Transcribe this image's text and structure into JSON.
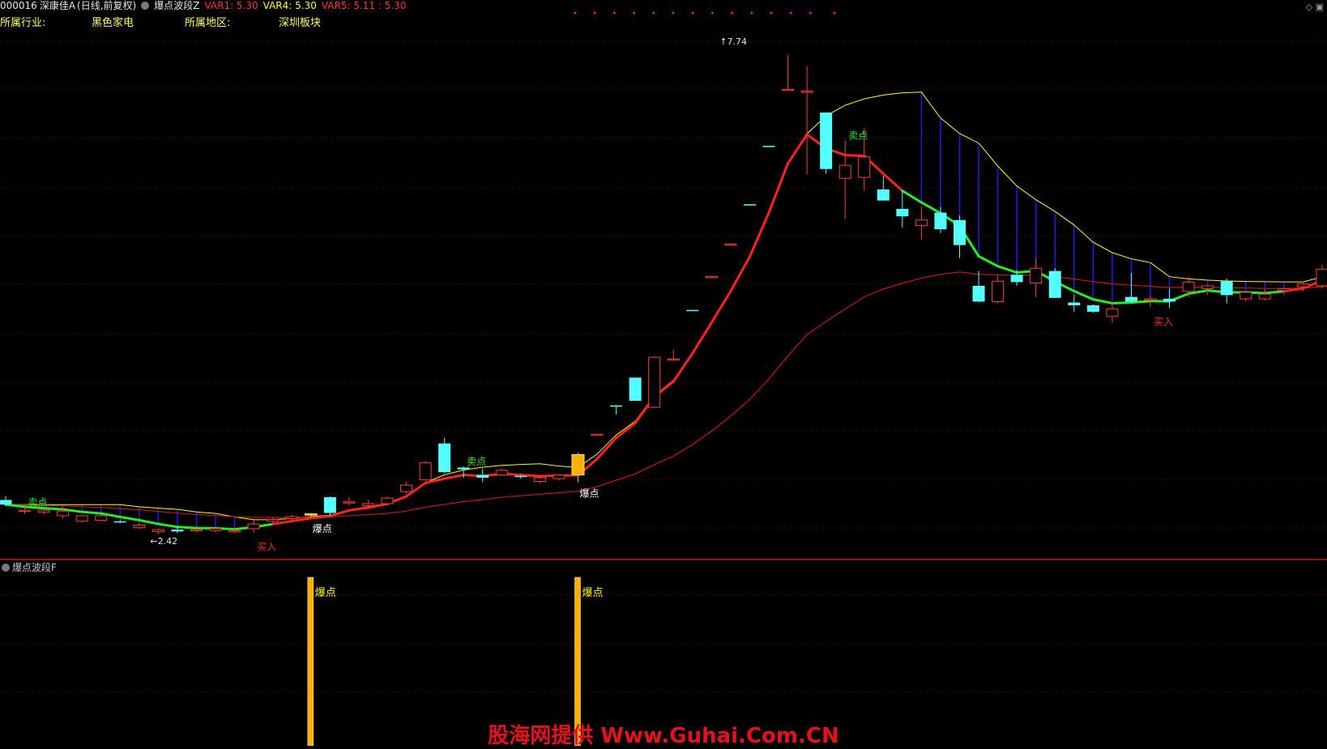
{
  "header": {
    "code": "000016",
    "name": "深康佳A",
    "mode": "(日线,前复权)",
    "indicator": "爆点波段Z",
    "var1": "VAR1: 5.30",
    "var4": "VAR4: 5.30",
    "var5": "VAR5: 5.11 : 5.30"
  },
  "info": {
    "industry_label": "所属行业:",
    "industry_value": "黑色家电",
    "region_label": "所属地区:",
    "region_value": "深圳板块"
  },
  "sub_panel": {
    "title": "爆点波段F"
  },
  "watermark": "股海网提供 Www.Guhai.Com.CN",
  "colors": {
    "up": "#ff3b3b",
    "down": "#54ffff",
    "yellow": "#ffff00",
    "green": "#22ee22",
    "red": "#ff2020",
    "darkred": "#c81414",
    "blue": "#1a1ae6",
    "orange": "#ffb000",
    "grid": "#7a0000",
    "magenta": "#ff00ff"
  },
  "chart_data": {
    "type": "candlestick",
    "ylim": [
      2.2,
      8.0
    ],
    "candles": [
      [
        2.79,
        2.83,
        2.73,
        2.74
      ],
      [
        2.67,
        2.71,
        2.64,
        2.68
      ],
      [
        2.66,
        2.7,
        2.63,
        2.68
      ],
      [
        2.62,
        2.71,
        2.59,
        2.67
      ],
      [
        2.56,
        2.63,
        2.55,
        2.62
      ],
      [
        2.57,
        2.63,
        2.56,
        2.62
      ],
      [
        2.56,
        2.58,
        2.54,
        2.55
      ],
      [
        2.49,
        2.55,
        2.48,
        2.52
      ],
      [
        2.45,
        2.48,
        2.42,
        2.47
      ],
      [
        2.47,
        2.5,
        2.43,
        2.45
      ],
      [
        2.46,
        2.49,
        2.44,
        2.47
      ],
      [
        2.46,
        2.49,
        2.44,
        2.48
      ],
      [
        2.45,
        2.49,
        2.43,
        2.46
      ],
      [
        2.48,
        2.56,
        2.44,
        2.53
      ],
      [
        2.56,
        2.6,
        2.53,
        2.58
      ],
      [
        2.59,
        2.63,
        2.57,
        2.61
      ],
      [
        2.63,
        2.65,
        2.6,
        2.64
      ],
      [
        2.82,
        2.83,
        2.62,
        2.65
      ],
      [
        2.76,
        2.82,
        2.73,
        2.77
      ],
      [
        2.73,
        2.79,
        2.7,
        2.75
      ],
      [
        2.75,
        2.83,
        2.73,
        2.81
      ],
      [
        2.88,
        2.99,
        2.86,
        2.95
      ],
      [
        3.01,
        3.21,
        2.99,
        3.19
      ],
      [
        3.4,
        3.46,
        3.08,
        3.09
      ],
      [
        3.14,
        3.15,
        3.03,
        3.12
      ],
      [
        3.06,
        3.13,
        2.98,
        3.03
      ],
      [
        3.06,
        3.13,
        3.05,
        3.11
      ],
      [
        3.05,
        3.06,
        3.02,
        3.04
      ],
      [
        2.99,
        3.05,
        2.97,
        3.03
      ],
      [
        3.02,
        3.07,
        3.0,
        3.06
      ],
      [
        3.28,
        3.3,
        2.98,
        3.06
      ],
      [
        3.5,
        3.5,
        3.49,
        3.5
      ],
      [
        3.81,
        3.81,
        3.71,
        3.8
      ],
      [
        4.11,
        4.11,
        3.96,
        3.86
      ],
      [
        3.79,
        4.34,
        3.78,
        4.33
      ],
      [
        4.3,
        4.41,
        4.31,
        4.31
      ],
      [
        4.84,
        4.84,
        4.83,
        4.83
      ],
      [
        5.2,
        5.2,
        5.19,
        5.2
      ],
      [
        5.55,
        5.55,
        5.54,
        5.55
      ],
      [
        5.98,
        5.98,
        5.97,
        5.97
      ],
      [
        6.61,
        6.61,
        6.6,
        6.6
      ],
      [
        7.22,
        7.59,
        7.21,
        7.22
      ],
      [
        7.2,
        7.47,
        6.3,
        7.2
      ],
      [
        6.97,
        6.95,
        6.31,
        6.36
      ],
      [
        6.26,
        6.67,
        5.82,
        6.4
      ],
      [
        6.27,
        6.8,
        6.13,
        6.49
      ],
      [
        6.14,
        6.29,
        6.02,
        6.02
      ],
      [
        5.93,
        6.13,
        5.73,
        5.85
      ],
      [
        5.75,
        5.96,
        5.6,
        5.81
      ],
      [
        5.89,
        5.95,
        5.67,
        5.71
      ],
      [
        5.81,
        5.86,
        5.4,
        5.54
      ],
      [
        5.1,
        5.26,
        4.92,
        4.93
      ],
      [
        4.93,
        5.21,
        4.91,
        5.15
      ],
      [
        5.22,
        5.27,
        5.1,
        5.14
      ],
      [
        5.13,
        5.4,
        4.98,
        5.29
      ],
      [
        5.26,
        5.29,
        4.97,
        4.97
      ],
      [
        4.92,
        5.01,
        4.82,
        4.89
      ],
      [
        4.89,
        4.9,
        4.81,
        4.82
      ],
      [
        4.77,
        4.93,
        4.7,
        4.85
      ],
      [
        4.98,
        5.24,
        4.92,
        4.93
      ],
      [
        4.96,
        4.99,
        4.87,
        4.96
      ],
      [
        4.96,
        5.07,
        4.86,
        4.93
      ],
      [
        5.04,
        5.2,
        4.98,
        5.14
      ],
      [
        5.07,
        5.11,
        5.0,
        5.1
      ],
      [
        5.15,
        5.18,
        4.91,
        5.0
      ],
      [
        4.96,
        5.04,
        4.93,
        5.03
      ],
      [
        4.96,
        5.06,
        4.94,
        5.01
      ],
      [
        5.05,
        5.08,
        5.0,
        5.07
      ],
      [
        5.09,
        5.15,
        5.04,
        5.12
      ],
      [
        5.1,
        5.33,
        5.07,
        5.28
      ],
      [
        5.3,
        5.36,
        5.24,
        5.34
      ]
    ],
    "burst_days": [
      16,
      30
    ],
    "buy_days": [
      13,
      60
    ],
    "sell_days": [
      1,
      24,
      44
    ],
    "annotations": {
      "low": "2.42",
      "high": "7.74",
      "burst": "爆点",
      "buy": "买入",
      "sell": "卖点"
    }
  }
}
